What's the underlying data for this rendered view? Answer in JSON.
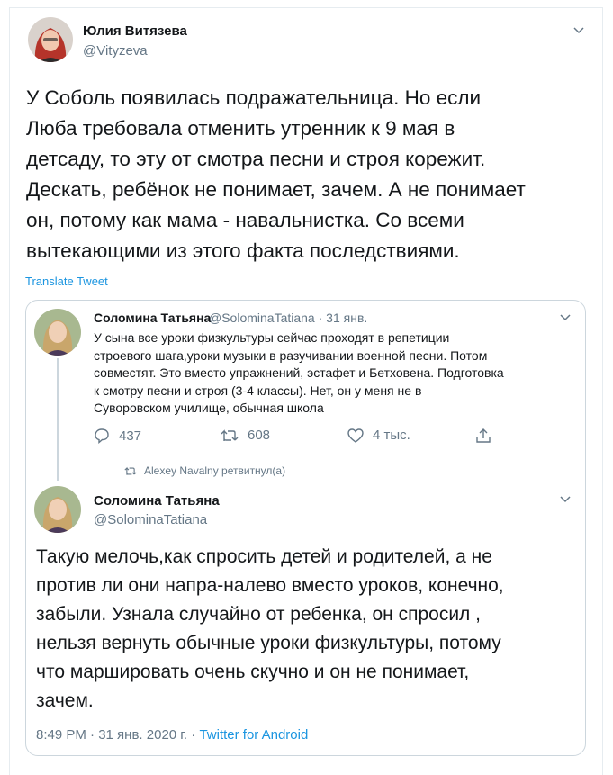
{
  "tweet": {
    "author_name": "Юлия Витязева",
    "author_handle": "@Vityzeva",
    "text": "У Соболь появилась подражательница. Но если\nЛюба требовала отменить утренник к 9 мая в\nдетсаду, то эту от смотра песни и строя корежит.\nДескать, ребёнок не понимает, зачем. А не понимает\nон, потому как мама - навальнистка. Со всеми\nвытекающими из этого факта последствиями.",
    "translate_label": "Translate Tweet"
  },
  "quoted": {
    "first": {
      "author_name": "Соломина Татьяна",
      "author_handle": "@SolominaTatiana · 31 янв.",
      "text": "У сына все уроки физкультуры сейчас проходят в репетиции\nстроевого шага,уроки музыки в разучивании военной песни. Потом\nсовместят. Это вместо упражнений, эстафет и Бетховена. Подготовка\nк смотру песни и строя (3-4 классы). Нет, он у меня не в\nСуворовском училище, обычная школа",
      "replies": "437",
      "retweets": "608",
      "likes": "4 тыс."
    },
    "retweeted_by": "Alexey Navalny ретвитнул(а)",
    "second": {
      "author_name": "Соломина Татьяна",
      "author_handle": "@SolominaTatiana",
      "text": "Такую мелочь,как спросить детей и родителей, а не\nпротив ли они напра-налево вместо уроков,  конечно,\nзабыли. Узнала случайно от ребенка, он спросил ,\nнельзя вернуть обычные уроки физкультуры, потому\nчто маршировать очень скучно и он не понимает,\nзачем.",
      "timestamp": "8:49 PM · 31 янв. 2020 г. · ",
      "source": "Twitter for Android"
    }
  },
  "colors": {
    "accent": "#1b95e0",
    "secondary_text": "#657786",
    "border": "#ccd6dd"
  },
  "icons": [
    "chevron-down-icon",
    "reply-icon",
    "retweet-icon",
    "like-icon",
    "share-icon"
  ]
}
